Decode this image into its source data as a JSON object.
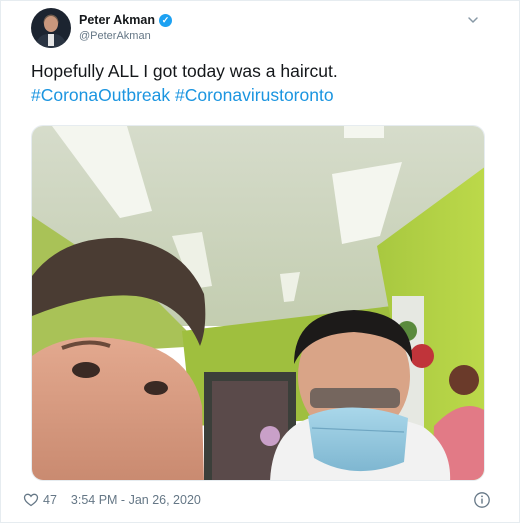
{
  "author": {
    "display_name": "Peter Akman",
    "handle": "@PeterAkman",
    "verified": true,
    "avatar_icon": "profile-photo"
  },
  "tweet": {
    "text": "Hopefully ALL I got today was a haircut.",
    "hashtags": [
      "#CoronaOutbreak",
      "#Coronavirustoronto"
    ]
  },
  "media": {
    "kind": "photo"
  },
  "footer": {
    "like_icon": "heart-outline",
    "like_count": "47",
    "timestamp": "3:54 PM - Jan 26, 2020",
    "info_icon": "info-circle"
  },
  "colors": {
    "hashtag": "#1b95e0",
    "verified": "#1da1f2",
    "muted": "#657786",
    "text": "#14171a"
  }
}
